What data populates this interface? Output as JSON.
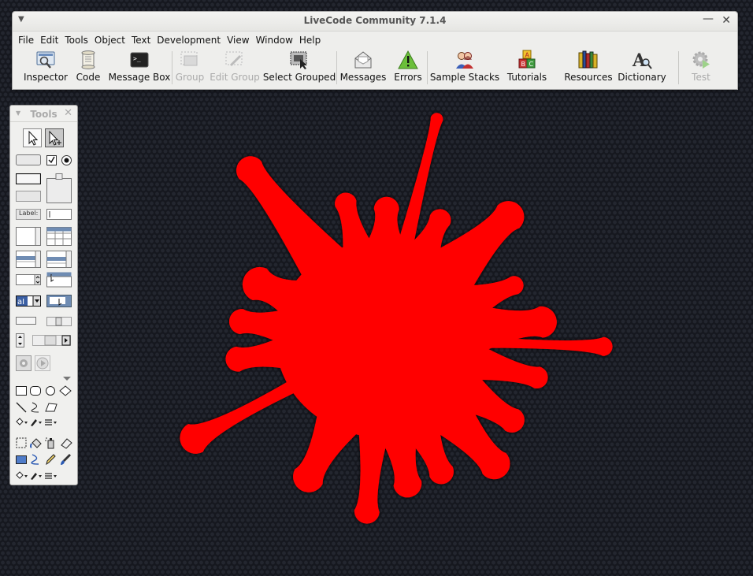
{
  "window": {
    "title": "LiveCode Community 7.1.4",
    "menu_icon": "chevron-down-icon",
    "minimize_symbol": "—",
    "close_symbol": "✕"
  },
  "menubar": [
    "File",
    "Edit",
    "Tools",
    "Object",
    "Text",
    "Development",
    "View",
    "Window",
    "Help"
  ],
  "toolbar": {
    "inspector": "Inspector",
    "code": "Code",
    "message_box": "Message Box",
    "group": "Group",
    "edit_group": "Edit Group",
    "select_grouped": "Select Grouped",
    "messages": "Messages",
    "errors": "Errors",
    "sample_stacks": "Sample Stacks",
    "tutorials": "Tutorials",
    "resources": "Resources",
    "dictionary": "Dictionary",
    "test": "Test"
  },
  "tools_palette": {
    "title": "Tools",
    "label_widget": "Label:",
    "close_symbol": "✕"
  },
  "colors": {
    "splash": "#ff0000",
    "background": "#16181f",
    "chrome": "#eeeeec"
  }
}
